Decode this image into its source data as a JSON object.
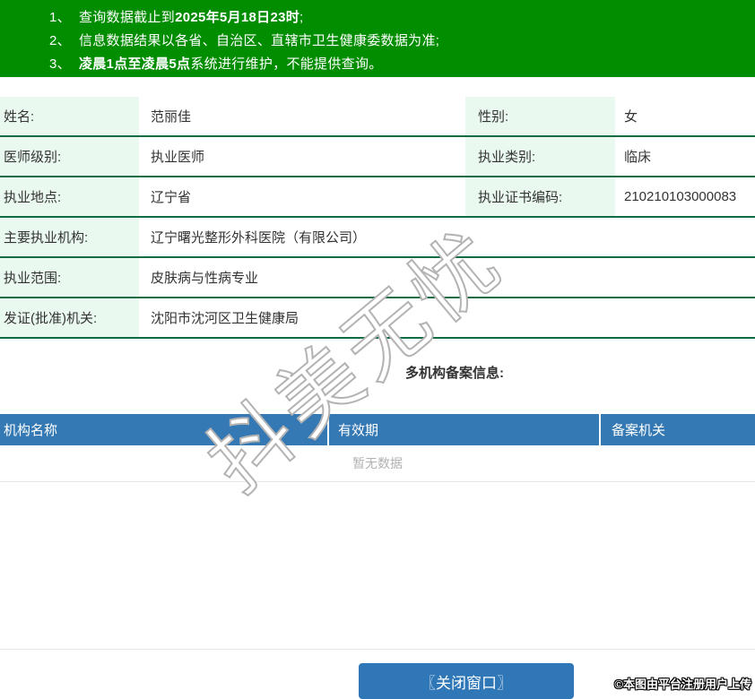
{
  "colors": {
    "green_bg": "#008d00",
    "label_bg": "#eaf9f0",
    "border_green": "#0e6b42",
    "blue_header": "#3579b4",
    "button_blue": "#3077b8",
    "empty_gray": "#b2b2b2"
  },
  "notice": {
    "items": [
      {
        "num": "1、",
        "pre": "查询数据截止到",
        "bold": "2025年5月18日23时",
        "post": ";"
      },
      {
        "num": "2、",
        "pre": "信息数据结果以各省、自治区、直辖市卫生健康委数据为准;",
        "bold": "",
        "post": ""
      },
      {
        "num": "3、",
        "pre": "",
        "bold": "凌晨1点至凌晨5点",
        "post": "系统进行维护，不能提供查询。"
      }
    ]
  },
  "info_table": {
    "rows": [
      {
        "cells": [
          {
            "label": "姓名:",
            "value": "范丽佳"
          },
          {
            "label": "性别:",
            "value": "女"
          }
        ]
      },
      {
        "cells": [
          {
            "label": "医师级别:",
            "value": "执业医师"
          },
          {
            "label": "执业类别:",
            "value": "临床"
          }
        ]
      },
      {
        "cells": [
          {
            "label": "执业地点:",
            "value": "辽宁省"
          },
          {
            "label": "执业证书编码:",
            "value": "210210103000083"
          }
        ]
      },
      {
        "cells": [
          {
            "label": "主要执业机构:",
            "value": "辽宁曙光整形外科医院（有限公司）"
          }
        ]
      },
      {
        "cells": [
          {
            "label": "执业范围:",
            "value": "皮肤病与性病专业"
          }
        ]
      },
      {
        "cells": [
          {
            "label": "发证(批准)机关:",
            "value": "沈阳市沈河区卫生健康局"
          }
        ]
      }
    ]
  },
  "filing_section": {
    "title": "多机构备案信息:",
    "columns": [
      "机构名称",
      "有效期",
      "备案机关"
    ],
    "empty_text": "暂无数据"
  },
  "footer": {
    "close_button_label": "〖关闭窗口〗",
    "copyright": "©本图由平台注册用户上传"
  },
  "watermark_text": "抖美无忧"
}
